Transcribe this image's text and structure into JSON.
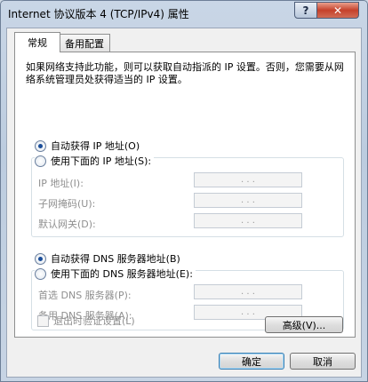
{
  "window": {
    "title": "Internet 协议版本 4 (TCP/IPv4) 属性",
    "help_label": "?",
    "close_label": "✕"
  },
  "tabs": [
    {
      "label": "常规",
      "active": true
    },
    {
      "label": "备用配置",
      "active": false
    }
  ],
  "description": "如果网络支持此功能，则可以获取自动指派的 IP 设置。否则，您需要从网络系统管理员处获得适当的 IP 设置。",
  "ip": {
    "auto_label": "自动获得 IP 地址(O)",
    "manual_label": "使用下面的 IP 地址(S):",
    "auto_selected": true,
    "fields": [
      {
        "label": "IP 地址(I):"
      },
      {
        "label": "子网掩码(U):"
      },
      {
        "label": "默认网关(D):"
      }
    ]
  },
  "dns": {
    "auto_label": "自动获得 DNS 服务器地址(B)",
    "manual_label": "使用下面的 DNS 服务器地址(E):",
    "auto_selected": true,
    "fields": [
      {
        "label": "首选 DNS 服务器(P):"
      },
      {
        "label": "备用 DNS 服务器(A):"
      }
    ]
  },
  "ip_dots": ".   .   .",
  "validate_label": "退出时验证设置(L)",
  "advanced_label": "高级(V)...",
  "ok_label": "确定",
  "cancel_label": "取消"
}
